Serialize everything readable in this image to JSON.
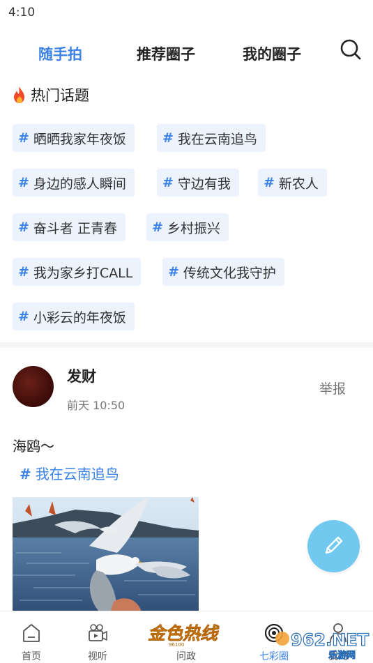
{
  "status": {
    "time": "4:10"
  },
  "tabs": [
    {
      "label": "随手拍",
      "active": true
    },
    {
      "label": "推荐圈子",
      "active": false
    },
    {
      "label": "我的圈子",
      "active": false
    }
  ],
  "hot_topics": {
    "title": "热门话题",
    "chips": [
      "晒晒我家年夜饭",
      "我在云南追鸟",
      "身边的感人瞬间",
      "守边有我",
      "新农人",
      "奋斗者 正青春",
      "乡村振兴",
      "我为家乡打CALL",
      "传统文化我守护",
      "小彩云的年夜饭"
    ]
  },
  "post": {
    "author": "发财",
    "time": "前天 10:50",
    "report_label": "举报",
    "text": "海鸥～",
    "topic": "我在云南追鸟"
  },
  "bottom_nav": {
    "items": [
      {
        "label": "首页",
        "icon": "home-icon"
      },
      {
        "label": "视听",
        "icon": "video-icon"
      },
      {
        "label": "问政",
        "icon": "hotline-logo"
      },
      {
        "label": "七彩圈",
        "icon": "circle-target-icon",
        "active": true
      },
      {
        "label": "我的",
        "icon": "profile-icon"
      }
    ],
    "logo_text": "金色热线",
    "logo_sub": "96100"
  },
  "watermark": {
    "text": "962.NET",
    "sub": "乐游网"
  },
  "colors": {
    "accent": "#3b82e6",
    "chip_bg": "#edf3fd",
    "fab": "#72c9ef",
    "logo": "#e6a012"
  }
}
